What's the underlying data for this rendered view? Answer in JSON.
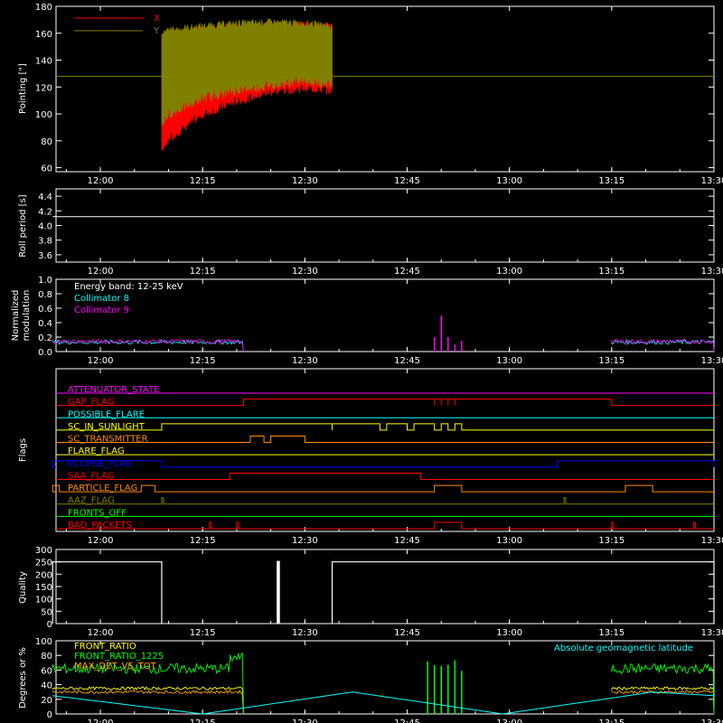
{
  "colors": {
    "background": "#000000",
    "axis": "#ffffff",
    "x_pointing": "#ff0000",
    "y_pointing": "#808000",
    "collimator_8": "#00ffff",
    "collimator_9": "#ff00ff",
    "latitude": "#00ffff",
    "front_ratio": "#ffff00",
    "front_ratio_1225": "#00ff00",
    "max_det": "#ffa500"
  },
  "chart_data": [
    {
      "type": "line",
      "panel": "pointing",
      "ylabel": "Pointing [\"]",
      "ylim": [
        57,
        180
      ],
      "yticks": [
        60,
        80,
        100,
        120,
        140,
        160,
        180
      ],
      "time_ticks": [
        "12:00",
        "12:15",
        "12:30",
        "12:45",
        "13:00",
        "13:15",
        "13:30"
      ],
      "legend": [
        "X",
        "Y"
      ],
      "reference_line": 128,
      "series": [
        {
          "name": "X",
          "x": [
            "12:09",
            "12:10",
            "12:15",
            "12:20",
            "12:25",
            "12:30",
            "12:34"
          ],
          "min": [
            75,
            82,
            100,
            110,
            117,
            120,
            118
          ],
          "max": [
            155,
            160,
            163,
            165,
            166,
            166,
            165
          ]
        },
        {
          "name": "Y",
          "x": [
            "12:09",
            "12:10",
            "12:15",
            "12:20",
            "12:25",
            "12:30",
            "12:34"
          ],
          "min": [
            95,
            100,
            112,
            118,
            122,
            125,
            123
          ],
          "max": [
            158,
            162,
            165,
            167,
            168,
            167,
            165
          ]
        }
      ]
    },
    {
      "type": "line",
      "panel": "roll_period",
      "ylabel": "Roll period [s]",
      "ylim": [
        3.5,
        4.5
      ],
      "yticks": [
        3.6,
        3.8,
        4.0,
        4.2,
        4.4
      ],
      "yticklabels": [
        "3.6",
        "3.8",
        "4.0",
        "4.2",
        "4.4"
      ],
      "time_ticks": [
        "12:00",
        "12:15",
        "12:30",
        "12:45",
        "13:00",
        "13:15",
        "13:30"
      ],
      "series": [
        {
          "name": "",
          "x": [
            "11:53",
            "13:30"
          ],
          "y": [
            4.12,
            4.12
          ]
        }
      ]
    },
    {
      "type": "line",
      "panel": "modulation",
      "ylabel": "Normalized modulation",
      "ylabel_lines": [
        "Normalized",
        "modulation"
      ],
      "ylim": [
        0,
        1
      ],
      "yticks": [
        0,
        0.2,
        0.4,
        0.6,
        0.8,
        1.0
      ],
      "yticklabels": [
        "0.0",
        "0.2",
        "0.4",
        "0.6",
        "0.8",
        "1.0"
      ],
      "time_ticks": [
        "12:00",
        "12:15",
        "12:30",
        "12:45",
        "13:00",
        "13:15",
        "13:30"
      ],
      "annotations": [
        "Energy band: 12-25 keV",
        "Collimator 8",
        "Collimator 9"
      ],
      "series": [
        {
          "name": "Collimator 8",
          "segments": [
            [
              "11:53",
              "12:21"
            ],
            [
              "13:15",
              "13:30"
            ]
          ],
          "level": 0.13
        },
        {
          "name": "Collimator 9",
          "segments": [
            [
              "11:53",
              "12:21"
            ],
            [
              "13:15",
              "13:30"
            ]
          ],
          "level": 0.14,
          "spikes": [
            [
              "12:49",
              0.2
            ],
            [
              "12:50",
              0.5
            ],
            [
              "12:51",
              0.2
            ],
            [
              "12:52",
              0.1
            ],
            [
              "12:53",
              0.15
            ]
          ]
        }
      ]
    },
    {
      "type": "table",
      "panel": "flags",
      "ylabel": "Flags",
      "time_ticks": [
        "12:00",
        "12:15",
        "12:30",
        "12:45",
        "13:00",
        "13:15",
        "13:30"
      ],
      "rows": [
        {
          "name": "ATTENUATOR_STATE",
          "color": "#ff00ff",
          "high": []
        },
        {
          "name": "GAP_FLAG",
          "color": "#ff0000",
          "high": [
            [
              "12:21",
              "12:49"
            ],
            [
              "12:49",
              "12:50"
            ],
            [
              "12:50",
              "12:51"
            ],
            [
              "12:51",
              "12:52"
            ],
            [
              "12:52",
              "13:15"
            ]
          ]
        },
        {
          "name": "POSSIBLE_FLARE",
          "color": "#00ffff",
          "high": []
        },
        {
          "name": "SC_IN_SUNLIGHT",
          "color": "#ffff00",
          "high": [
            [
              "12:09",
              "12:34"
            ],
            [
              "12:34",
              "12:41"
            ],
            [
              "12:42",
              "12:45"
            ],
            [
              "12:46",
              "12:49"
            ],
            [
              "12:50",
              "12:51"
            ],
            [
              "12:52",
              "12:53"
            ]
          ]
        },
        {
          "name": "SC_TRANSMITTER",
          "color": "#ff8c00",
          "high": [
            [
              "12:22",
              "12:24"
            ],
            [
              "12:25",
              "12:30"
            ]
          ]
        },
        {
          "name": "FLARE_FLAG",
          "color": "#ffff00",
          "high": []
        },
        {
          "name": "ECLIPSE_FLAG",
          "color": "#0000ff",
          "high": [
            [
              "11:53",
              "12:09"
            ],
            [
              "13:07",
              "13:30"
            ]
          ]
        },
        {
          "name": "SAA_FLAG",
          "color": "#ff0000",
          "high": [
            [
              "12:19",
              "12:47"
            ]
          ]
        },
        {
          "name": "PARTICLE_FLAG",
          "color": "#ff8c00",
          "high": [
            [
              "11:53",
              "11:54"
            ],
            [
              "12:06",
              "12:08"
            ],
            [
              "12:49",
              "12:53"
            ],
            [
              "13:17",
              "13:21"
            ]
          ]
        },
        {
          "name": "AAZ_FLAG",
          "color": "#808000",
          "high": [
            [
              "12:09",
              "12:09"
            ],
            [
              "13:08",
              "13:08"
            ]
          ]
        },
        {
          "name": "FRONTS_OFF",
          "color": "#00ff00",
          "high": []
        },
        {
          "name": "BAD_PACKETS",
          "color": "#ff0000",
          "high": [
            [
              "12:16",
              "12:16"
            ],
            [
              "12:20",
              "12:20"
            ],
            [
              "12:49",
              "12:53"
            ],
            [
              "13:15",
              "13:15"
            ],
            [
              "13:27",
              "13:27"
            ]
          ]
        }
      ]
    },
    {
      "type": "line",
      "panel": "quality",
      "ylabel": "Quality",
      "ylim": [
        0,
        300
      ],
      "yticks": [
        0,
        50,
        100,
        150,
        200,
        250,
        300
      ],
      "time_ticks": [
        "12:00",
        "12:15",
        "12:30",
        "12:45",
        "13:00",
        "13:15",
        "13:30"
      ],
      "series": [
        {
          "name": "",
          "segments": [
            [
              "11:53",
              "12:09",
              250
            ],
            [
              "12:26",
              "12:26",
              250
            ],
            [
              "12:34",
              "13:30",
              250
            ]
          ]
        }
      ]
    },
    {
      "type": "line",
      "panel": "ratios",
      "ylabel": "Degrees or %",
      "ylim": [
        0,
        100
      ],
      "yticks": [
        0,
        20,
        40,
        60,
        80,
        100
      ],
      "time_ticks": [
        "12:00",
        "12:15",
        "12:30",
        "12:45",
        "13:00",
        "13:15",
        "13:30"
      ],
      "legend": [
        "FRONT_RATIO",
        "FRONT_RATIO_1225",
        "MAX_DET_VS_TOT",
        "Absolute geomagnetic latitude"
      ],
      "series": [
        {
          "name": "FRONT_RATIO",
          "segments": [
            [
              "11:53",
              "12:21"
            ],
            [
              "13:15",
              "13:30"
            ]
          ],
          "level": 35
        },
        {
          "name": "FRONT_RATIO_1225",
          "segments": [
            [
              "11:53",
              "12:21"
            ],
            [
              "13:15",
              "13:30"
            ]
          ],
          "level": 62
        },
        {
          "name": "MAX_DET_VS_TOT",
          "segments": [
            [
              "11:53",
              "12:21"
            ],
            [
              "13:15",
              "13:30"
            ]
          ],
          "level": 30
        },
        {
          "name": "Absolute geomagnetic latitude",
          "x": [
            "11:53",
            "12:15",
            "12:37",
            "12:59",
            "13:21",
            "13:30"
          ],
          "y": [
            25,
            0,
            30,
            0,
            30,
            25
          ]
        }
      ]
    }
  ]
}
